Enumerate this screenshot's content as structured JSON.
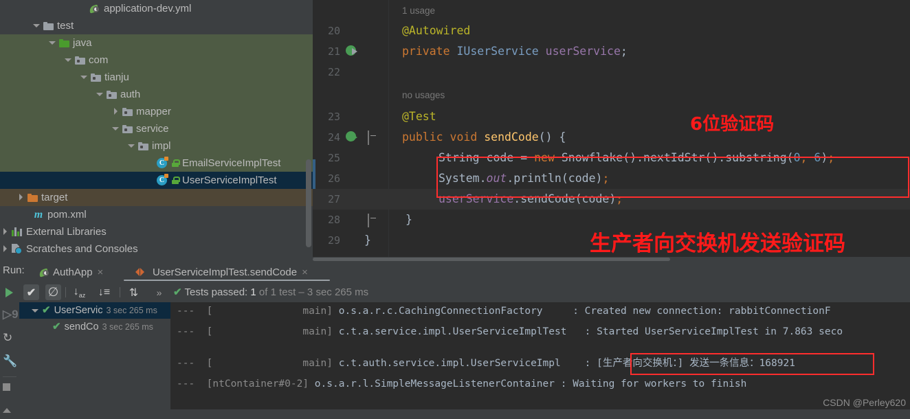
{
  "project_tree": {
    "items": [
      {
        "label": "application-dev.yml",
        "icon": "spring-leaf-icon",
        "indent": 130,
        "arrow": "none",
        "state": "none",
        "icon_type": "spring"
      },
      {
        "label": "test",
        "icon": "folder-grey-icon",
        "indent": 48,
        "arrow": "down",
        "state": "none",
        "icon_type": "folder-grey"
      },
      {
        "label": "java",
        "icon": "folder-green-icon",
        "indent": 71,
        "arrow": "down",
        "state": "green",
        "icon_type": "folder-green"
      },
      {
        "label": "com",
        "icon": "package-icon",
        "indent": 94,
        "arrow": "down",
        "state": "green",
        "icon_type": "folder-pkg"
      },
      {
        "label": "tianju",
        "icon": "package-icon",
        "indent": 117,
        "arrow": "down",
        "state": "green",
        "icon_type": "folder-pkg"
      },
      {
        "label": "auth",
        "icon": "package-icon",
        "indent": 140,
        "arrow": "down",
        "state": "green",
        "icon_type": "folder-pkg"
      },
      {
        "label": "mapper",
        "icon": "package-icon",
        "indent": 163,
        "arrow": "right",
        "state": "green",
        "icon_type": "folder-pkg"
      },
      {
        "label": "service",
        "icon": "package-icon",
        "indent": 163,
        "arrow": "down",
        "state": "green",
        "icon_type": "folder-pkg"
      },
      {
        "label": "impl",
        "icon": "package-icon",
        "indent": 186,
        "arrow": "down",
        "state": "green",
        "icon_type": "folder-pkg"
      },
      {
        "label": "EmailServiceImplTest",
        "icon": "test-class-icon",
        "indent": 228,
        "arrow": "none",
        "state": "green",
        "icon_type": "class"
      },
      {
        "label": "UserServiceImplTest",
        "icon": "test-class-icon",
        "indent": 228,
        "arrow": "none",
        "state": "blue",
        "icon_type": "class"
      },
      {
        "label": "target",
        "icon": "folder-orange-icon",
        "indent": 25,
        "arrow": "right",
        "state": "brown",
        "icon_type": "folder-orange"
      },
      {
        "label": "pom.xml",
        "icon": "maven-icon",
        "indent": 48,
        "arrow": "none",
        "state": "none",
        "icon_type": "maven"
      },
      {
        "label": "External Libraries",
        "icon": "libraries-icon",
        "indent": 2,
        "arrow": "right",
        "state": "none",
        "icon_type": "bars"
      },
      {
        "label": "Scratches and Consoles",
        "icon": "scratches-icon",
        "indent": 2,
        "arrow": "right",
        "state": "none",
        "icon_type": "scratch"
      }
    ]
  },
  "editor": {
    "lines": [
      {
        "number": "20",
        "text": "@Autowired",
        "gutter": "none"
      },
      {
        "number": "21",
        "text": "private IUserService userService;",
        "gutter": "implemented-arrow-icon"
      },
      {
        "number": "22",
        "text": "",
        "gutter": "none"
      },
      {
        "number": "23",
        "text": "@Test",
        "gutter": "none"
      },
      {
        "number": "24",
        "text": "public void sendCode() {",
        "gutter": "run-test-icon"
      },
      {
        "number": "25",
        "text": "String code = new Snowflake().nextIdStr().substring(0, 6);",
        "gutter": "none"
      },
      {
        "number": "26",
        "text": "System.out.println(code);",
        "gutter": "none"
      },
      {
        "number": "27",
        "text": "userService.sendCode(code);",
        "gutter": "none"
      },
      {
        "number": "28",
        "text": "}",
        "gutter": "none"
      },
      {
        "number": "29",
        "text": "}",
        "gutter": "none"
      }
    ],
    "usage_hints": [
      {
        "text": "1 usage"
      },
      {
        "text": "no usages"
      }
    ],
    "annotations": [
      {
        "text": "6位验证码",
        "id": "six-digit-code-note"
      },
      {
        "text": "生产者向交换机发送验证码",
        "id": "producer-sends-code-note"
      }
    ]
  },
  "run_panel": {
    "run_label": "Run:",
    "tabs": [
      {
        "label": "AuthApp",
        "icon": "spring-boot-icon",
        "active": false,
        "close": "×"
      },
      {
        "label": "UserServiceImplTest.sendCode",
        "icon": "test-run-icon",
        "active": true,
        "close": "×"
      }
    ],
    "toolbar": {
      "icons": [
        {
          "name": "rerun-icon",
          "glyph": "▶"
        },
        {
          "name": "show-passed-toggle",
          "glyph": "✔"
        },
        {
          "name": "show-ignored-toggle",
          "glyph": "⊘"
        },
        {
          "name": "sort-alphabetically-icon",
          "glyph": "↓"
        },
        {
          "name": "sort-by-duration-icon",
          "glyph": "↓"
        },
        {
          "name": "expand-collapse-icon",
          "glyph": "↕"
        },
        {
          "name": "more-options-icon",
          "glyph": "»"
        }
      ]
    },
    "status": {
      "check": "✔",
      "prefix": "Tests passed: ",
      "count": "1",
      "suffix": " of 1 test – 3 sec 265 ms"
    },
    "left_gutter_icons": [
      {
        "name": "run-icon",
        "glyph": "▶"
      },
      {
        "name": "debug-icon",
        "glyph": "❰"
      },
      {
        "name": "rerun-tests-icon",
        "glyph": "↻"
      },
      {
        "name": "settings-wrench-icon",
        "glyph": "🔧"
      },
      {
        "name": "stop-icon",
        "glyph": "■"
      },
      {
        "name": "pin-icon",
        "glyph": "▲"
      }
    ],
    "test_tree": [
      {
        "label": "UserServic",
        "time": "3 sec 265 ms",
        "selected": true,
        "arrow": "down",
        "indent": 18
      },
      {
        "label": "sendCo",
        "time": "3 sec 265 ms",
        "selected": false,
        "arrow": "none",
        "indent": 48
      }
    ],
    "console": {
      "lines": [
        {
          "prefix": "---  [",
          "thread": "               main]",
          "logger": " o.s.a.r.c.CachingConnectionFactory",
          "sep": "     : ",
          "message": "Created new connection: rabbitConnectionF"
        },
        {
          "prefix": "---  [",
          "thread": "               main]",
          "logger": " c.t.a.service.impl.UserServiceImplTest",
          "sep": "   : ",
          "message": "Started UserServiceImplTest in 7.863 seco"
        },
        {
          "prefix": "",
          "thread": "",
          "logger": "",
          "sep": "",
          "message": ""
        },
        {
          "prefix": "---  [",
          "thread": "               main]",
          "logger": " c.t.auth.service.impl.UserServiceImpl",
          "sep": "    : ",
          "message": "[生产者向交换机：] 发送一条信息：168921"
        },
        {
          "prefix": "---  [",
          "thread": "ntContainer#0-2]",
          "logger": " o.s.a.r.l.SimpleMessageListenerContainer",
          "sep": " : ",
          "message": "Waiting for workers to finish"
        }
      ],
      "watermark": "CSDN @Perley620"
    }
  },
  "colors": {
    "accent_red": "#ff2d2d",
    "panel_bg": "#3c3f41",
    "editor_bg": "#2b2b2b",
    "selection_blue": "#0d293e",
    "selection_green": "#4e5b44",
    "selection_brown": "#4f4636",
    "green_pass": "#59a869"
  }
}
